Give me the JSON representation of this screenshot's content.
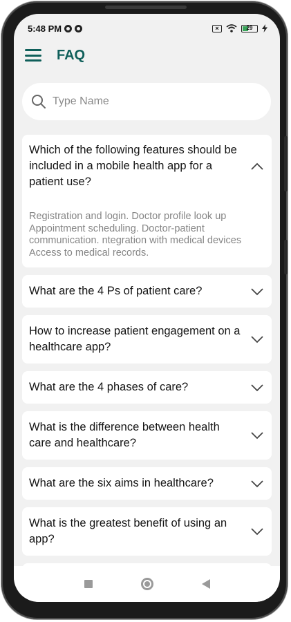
{
  "status_bar": {
    "time": "5:48 PM",
    "battery_level": "29"
  },
  "header": {
    "title": "FAQ"
  },
  "search": {
    "placeholder": "Type Name",
    "value": ""
  },
  "faqs": [
    {
      "question": "Which of the following features should be included in a mobile health app for a patient use?",
      "expanded": true,
      "answer": "Registration and login. Doctor profile look up Appointment scheduling. Doctor-patient communication. ntegration with medical devices Access to medical records."
    },
    {
      "question": "What are the 4 Ps of patient care?",
      "expanded": false
    },
    {
      "question": "How to increase patient engagement on a healthcare app?",
      "expanded": false
    },
    {
      "question": "What are the 4 phases of care?",
      "expanded": false
    },
    {
      "question": "What is the difference between health care and healthcare?",
      "expanded": false
    },
    {
      "question": "What are the six aims in healthcare?",
      "expanded": false
    },
    {
      "question": "What is the greatest benefit of using an app?",
      "expanded": false
    }
  ],
  "colors": {
    "brand": "#0f5f5a",
    "screen_bg": "#f1f1f1",
    "card_bg": "#ffffff",
    "answer_text": "#858585"
  },
  "icons": {
    "menu": "hamburger-icon",
    "search": "search-icon",
    "expanded": "chevron-up-icon",
    "collapsed": "chevron-down-icon",
    "nav": [
      "recents-square-icon",
      "home-circle-icon",
      "back-triangle-icon"
    ]
  }
}
